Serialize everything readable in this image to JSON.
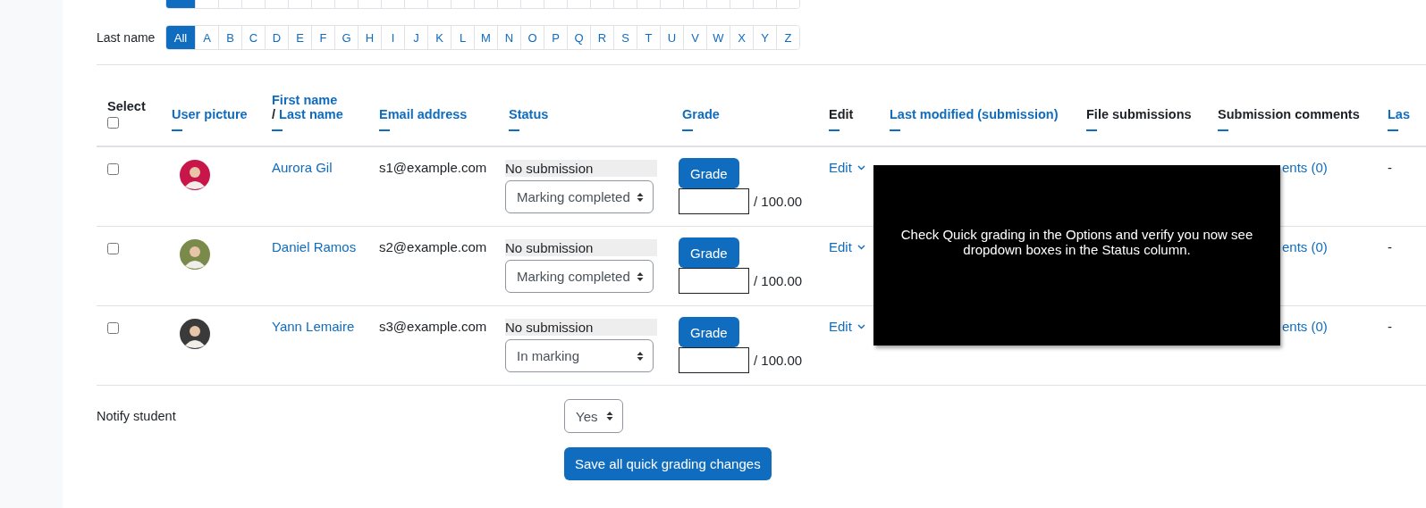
{
  "first_name_filter": {
    "buttons": [
      {
        "selected": true
      },
      {
        "selected": false
      },
      {
        "selected": false
      },
      {
        "selected": false
      },
      {
        "selected": false
      },
      {
        "selected": false
      },
      {
        "selected": false
      },
      {
        "selected": false
      },
      {
        "selected": false
      },
      {
        "selected": false
      },
      {
        "selected": false
      },
      {
        "selected": false
      },
      {
        "selected": false
      },
      {
        "selected": false
      },
      {
        "selected": false
      },
      {
        "selected": false
      },
      {
        "selected": false
      },
      {
        "selected": false
      },
      {
        "selected": false
      },
      {
        "selected": false
      },
      {
        "selected": false
      },
      {
        "selected": false
      },
      {
        "selected": false
      },
      {
        "selected": false
      },
      {
        "selected": false
      },
      {
        "selected": false
      },
      {
        "selected": false
      }
    ]
  },
  "last_name_filter": {
    "label": "Last name",
    "buttons": [
      {
        "label": "All",
        "selected": true
      },
      {
        "label": "A",
        "selected": false
      },
      {
        "label": "B",
        "selected": false
      },
      {
        "label": "C",
        "selected": false
      },
      {
        "label": "D",
        "selected": false
      },
      {
        "label": "E",
        "selected": false
      },
      {
        "label": "F",
        "selected": false
      },
      {
        "label": "G",
        "selected": false
      },
      {
        "label": "H",
        "selected": false
      },
      {
        "label": "I",
        "selected": false
      },
      {
        "label": "J",
        "selected": false
      },
      {
        "label": "K",
        "selected": false
      },
      {
        "label": "L",
        "selected": false
      },
      {
        "label": "M",
        "selected": false
      },
      {
        "label": "N",
        "selected": false
      },
      {
        "label": "O",
        "selected": false
      },
      {
        "label": "P",
        "selected": false
      },
      {
        "label": "Q",
        "selected": false
      },
      {
        "label": "R",
        "selected": false
      },
      {
        "label": "S",
        "selected": false
      },
      {
        "label": "T",
        "selected": false
      },
      {
        "label": "U",
        "selected": false
      },
      {
        "label": "V",
        "selected": false
      },
      {
        "label": "W",
        "selected": false
      },
      {
        "label": "X",
        "selected": false
      },
      {
        "label": "Y",
        "selected": false
      },
      {
        "label": "Z",
        "selected": false
      }
    ]
  },
  "table": {
    "columns": [
      {
        "kind": "select",
        "label": "Select",
        "checked": false
      },
      {
        "kind": "link",
        "label": "User picture"
      },
      {
        "kind": "name",
        "label": "First name",
        "label_2": "Last name",
        "separator": "/"
      },
      {
        "kind": "link",
        "label": "Email address"
      },
      {
        "kind": "link",
        "label": "Status"
      },
      {
        "kind": "link",
        "label": "Grade"
      },
      {
        "kind": "plain",
        "label": "Edit"
      },
      {
        "kind": "link",
        "label": "Last modified (submission)"
      },
      {
        "kind": "plain",
        "label": "File submissions"
      },
      {
        "kind": "plain",
        "label": "Submission comments"
      },
      {
        "kind": "link",
        "label": "Las"
      }
    ],
    "rows": [
      {
        "checked": false,
        "name": "Aurora Gil",
        "email": "s1@example.com",
        "status": "No submission",
        "marking": "Marking completed",
        "grade_button": "Grade",
        "grade_value": "",
        "grade_max": "/ 100.00",
        "edit": "Edit",
        "comments": "ents (0)",
        "last": "-"
      },
      {
        "checked": false,
        "name": "Daniel Ramos",
        "email": "s2@example.com",
        "status": "No submission",
        "marking": "Marking completed",
        "grade_button": "Grade",
        "grade_value": "",
        "grade_max": "/ 100.00",
        "edit": "Edit",
        "comments": "ents (0)",
        "last": "-"
      },
      {
        "checked": false,
        "name": "Yann Lemaire",
        "email": "s3@example.com",
        "status": "No submission",
        "marking": "In marking",
        "grade_button": "Grade",
        "grade_value": "",
        "grade_max": "/ 100.00",
        "edit": "Edit",
        "comments": "ents (0)",
        "last": "-"
      }
    ]
  },
  "notify": {
    "label": "Notify student",
    "value": "Yes"
  },
  "save_button": "Save all quick grading changes",
  "overlay": {
    "text": "Check Quick grading in the Options and verify you now see dropdown boxes in the Status column."
  }
}
